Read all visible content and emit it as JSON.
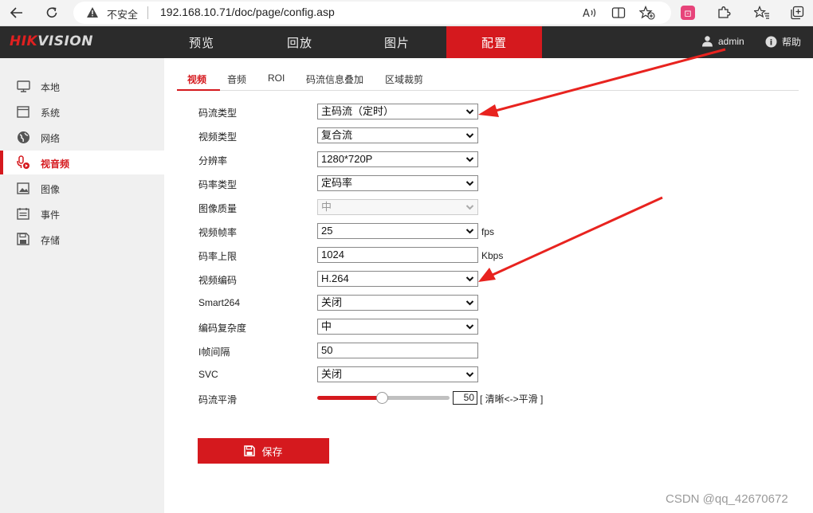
{
  "browser": {
    "insecure_label": "不安全",
    "url": "192.168.10.71/doc/page/config.asp",
    "profile_badge": "Ⓘ"
  },
  "brand": {
    "logo_red": "HIK",
    "logo_gray": "VISION"
  },
  "topnav": {
    "items": [
      "预览",
      "回放",
      "图片",
      "配置"
    ],
    "active_index": 3,
    "user": "admin",
    "help": "帮助"
  },
  "sidebar": {
    "items": [
      "本地",
      "系统",
      "网络",
      "视音频",
      "图像",
      "事件",
      "存储"
    ],
    "active_index": 3
  },
  "tabs": {
    "items": [
      "视频",
      "音频",
      "ROI",
      "码流信息叠加",
      "区域裁剪"
    ],
    "active_index": 0
  },
  "form": {
    "rows": [
      {
        "label": "码流类型",
        "value": "主码流（定时）",
        "type": "select"
      },
      {
        "label": "视频类型",
        "value": "复合流",
        "type": "select"
      },
      {
        "label": "分辨率",
        "value": "1280*720P",
        "type": "select"
      },
      {
        "label": "码率类型",
        "value": "定码率",
        "type": "select"
      },
      {
        "label": "图像质量",
        "value": "中",
        "type": "select-disabled"
      },
      {
        "label": "视频帧率",
        "value": "25",
        "type": "select",
        "unit": "fps"
      },
      {
        "label": "码率上限",
        "value": "1024",
        "type": "input",
        "unit": "Kbps"
      },
      {
        "label": "视频编码",
        "value": "H.264",
        "type": "select"
      },
      {
        "label": "Smart264",
        "value": "关闭",
        "type": "select"
      },
      {
        "label": "编码复杂度",
        "value": "中",
        "type": "select"
      },
      {
        "label": "I帧间隔",
        "value": "50",
        "type": "input"
      },
      {
        "label": "SVC",
        "value": "关闭",
        "type": "select"
      }
    ],
    "smooth": {
      "label": "码流平滑",
      "value": "50",
      "hint": "[ 清晰<->平滑 ]",
      "level": 50
    }
  },
  "save_label": "保存",
  "watermark": "CSDN @qq_42670672",
  "colors": {
    "accent": "#d5191e",
    "nav_bg": "#2b2b2b",
    "sidebar_bg": "#f0f0f0",
    "annotation_arrow": "#e8231f"
  }
}
